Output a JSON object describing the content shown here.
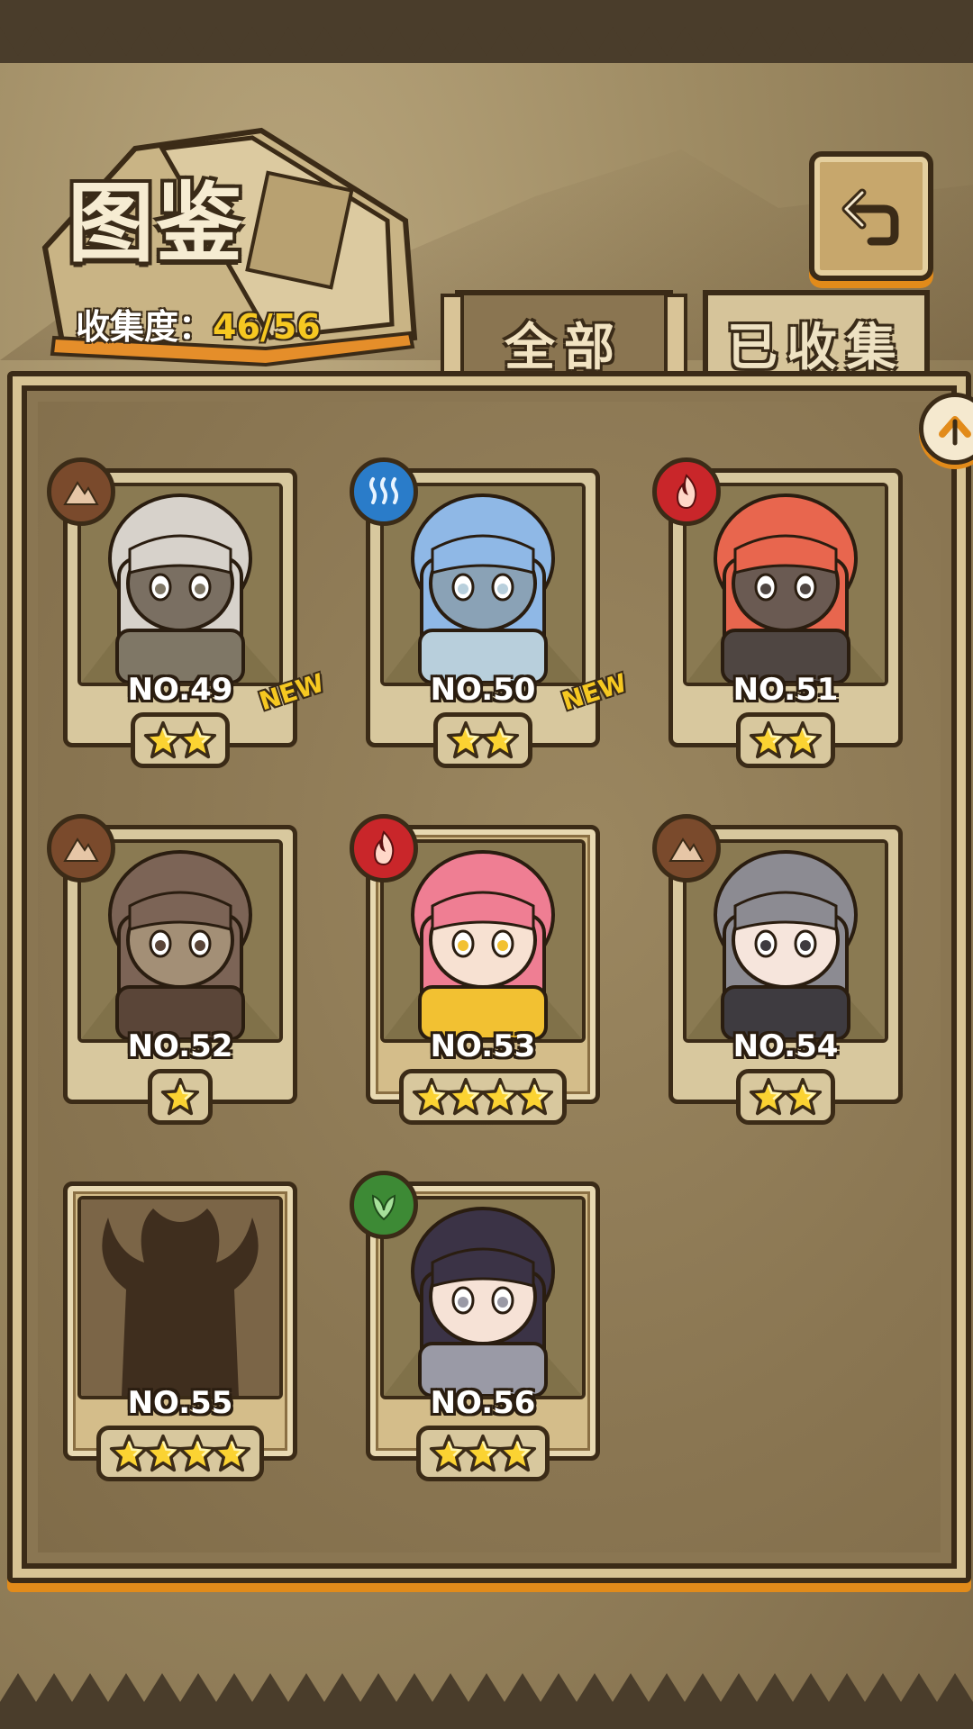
{
  "header": {
    "title": "图鉴",
    "collection_label": "收集度：",
    "collection_value": "46/56"
  },
  "tabs": [
    {
      "label": "全部",
      "active": true
    },
    {
      "label": "已收集",
      "active": false
    }
  ],
  "cards": [
    {
      "no": "NO.49",
      "element": "earth",
      "stars": 2,
      "new": "NEW",
      "silhouette": false,
      "hair": "#d7d2cb",
      "skin": "#7a6f62",
      "accent": "#7f7766"
    },
    {
      "no": "NO.50",
      "element": "water",
      "stars": 2,
      "new": "NEW",
      "silhouette": false,
      "hair": "#8fb8e6",
      "skin": "#8aa2b6",
      "accent": "#b8cfdc"
    },
    {
      "no": "NO.51",
      "element": "fire",
      "stars": 2,
      "new": "",
      "silhouette": false,
      "hair": "#e8664e",
      "skin": "#6a5a52",
      "accent": "#4f4642"
    },
    {
      "no": "NO.52",
      "element": "earth",
      "stars": 1,
      "new": "",
      "silhouette": false,
      "hair": "#7c6456",
      "skin": "#a38f76",
      "accent": "#5a4538"
    },
    {
      "no": "NO.53",
      "element": "fire",
      "stars": 4,
      "new": "",
      "silhouette": false,
      "hair": "#ef7e93",
      "skin": "#f7e1d2",
      "accent": "#f2c132"
    },
    {
      "no": "NO.54",
      "element": "earth",
      "stars": 2,
      "new": "",
      "silhouette": false,
      "hair": "#8c8b92",
      "skin": "#f6e5dc",
      "accent": "#3e3b40"
    },
    {
      "no": "NO.55",
      "element": "",
      "stars": 4,
      "new": "",
      "silhouette": true,
      "hair": "#3f2e1e",
      "skin": "#3f2e1e",
      "accent": "#3f2e1e"
    },
    {
      "no": "NO.56",
      "element": "grass",
      "stars": 3,
      "new": "",
      "silhouette": false,
      "hair": "#3b3346",
      "skin": "#f6e2d6",
      "accent": "#9a9aa6"
    }
  ],
  "icons": {
    "back": "return-arrow-icon",
    "scroll": "chevron-up-icon",
    "earth": "mountain-icon",
    "water": "wave-icon",
    "fire": "flame-icon",
    "grass": "leaf-icon",
    "star": "star-icon"
  }
}
